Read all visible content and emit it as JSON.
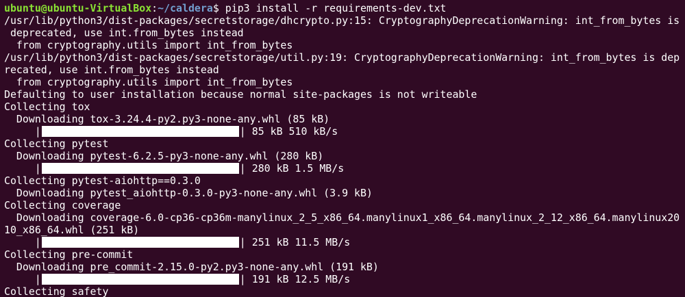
{
  "clipped_top": "                                                   '                           ''",
  "prompt": {
    "user_host": "ubuntu@ubuntu-VirtualBox",
    "separator": ":",
    "path": "~/caldera",
    "symbol": "$ ",
    "command": "pip3 install -r requirements-dev.txt"
  },
  "lines": [
    "/usr/lib/python3/dist-packages/secretstorage/dhcrypto.py:15: CryptographyDeprecationWarning: int_from_bytes is",
    " deprecated, use int.from_bytes instead",
    "  from cryptography.utils import int_from_bytes",
    "/usr/lib/python3/dist-packages/secretstorage/util.py:19: CryptographyDeprecationWarning: int_from_bytes is dep",
    "recated, use int.from_bytes instead",
    "  from cryptography.utils import int_from_bytes",
    "Defaulting to user installation because normal site-packages is not writeable",
    "Collecting tox",
    "  Downloading tox-3.24.4-py2.py3-none-any.whl (85 kB)"
  ],
  "progress": [
    {
      "text": "| 85 kB 510 kB/s",
      "fraction": 1.0
    },
    {
      "text": "| 280 kB 1.5 MB/s",
      "fraction": 1.0
    },
    {
      "text": "| 251 kB 11.5 MB/s",
      "fraction": 1.0
    },
    {
      "text": "| 191 kB 12.5 MB/s",
      "fraction": 1.0
    }
  ],
  "bar_prefix": "     |",
  "lines2": [
    "Collecting pytest",
    "  Downloading pytest-6.2.5-py3-none-any.whl (280 kB)"
  ],
  "lines3": [
    "Collecting pytest-aiohttp==0.3.0",
    "  Downloading pytest_aiohttp-0.3.0-py3-none-any.whl (3.9 kB)",
    "Collecting coverage",
    "  Downloading coverage-6.0-cp36-cp36m-manylinux_2_5_x86_64.manylinux1_x86_64.manylinux_2_12_x86_64.manylinux20",
    "10_x86_64.whl (251 kB)"
  ],
  "lines4": [
    "Collecting pre-commit",
    "  Downloading pre_commit-2.15.0-py2.py3-none-any.whl (191 kB)"
  ],
  "lines5": [
    "Collecting safety"
  ],
  "colors": {
    "background": "#300a24",
    "user_host": "#8ae234",
    "path": "#729fcf",
    "text": "#ffffff"
  }
}
